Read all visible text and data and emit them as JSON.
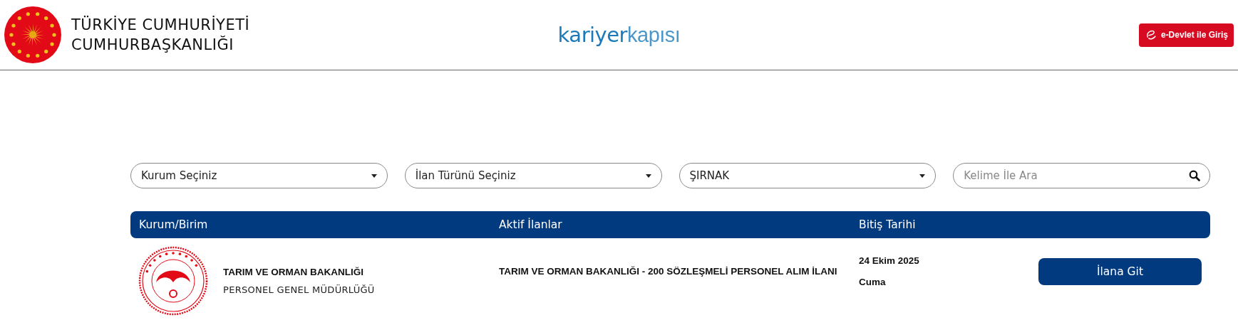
{
  "header": {
    "org_lines": [
      "TÜRKİYE CUMHURİYETİ",
      "CUMHURBAŞKANLIĞI"
    ],
    "brand": {
      "part_1": "kariyer",
      "part_2": "kapısı"
    },
    "login_button": "e-Devlet ile Giriş"
  },
  "filters": [
    {
      "kind": "select",
      "value": "Kurum Seçiniz"
    },
    {
      "kind": "select",
      "value": "İlan Türünü Seçiniz"
    },
    {
      "kind": "select",
      "value": "ŞIRNAK"
    },
    {
      "kind": "search",
      "placeholder": "Kelime İle Ara"
    }
  ],
  "table": {
    "columns": [
      "Kurum/Birim",
      "Aktif İlanlar",
      "Bitiş Tarihi"
    ],
    "rows": [
      {
        "institution": "TARIM VE ORMAN BAKANLIĞI",
        "unit": "PERSONEL GENEL MÜDÜRLÜĞÜ",
        "listing": "TARIM VE ORMAN BAKANLIĞI - 200 SÖZLEŞMELİ PERSONEL ALIM İLANI",
        "date": "24 Ekim 2025",
        "day": "Cuma",
        "action": "İlana Git"
      }
    ]
  }
}
